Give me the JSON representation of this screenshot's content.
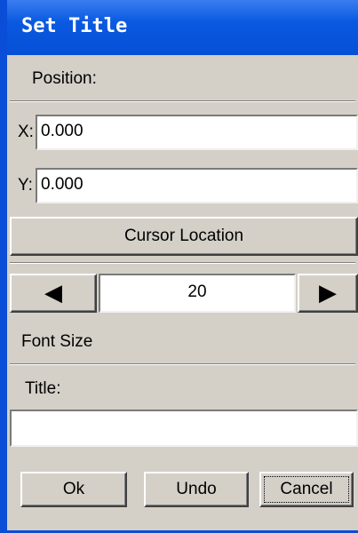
{
  "window": {
    "title": "Set Title"
  },
  "position": {
    "heading": "Position:",
    "x_label": "X:",
    "x_value": "0.000",
    "y_label": "Y:",
    "y_value": "0.000",
    "cursor_button": "Cursor Location"
  },
  "font": {
    "prev_glyph": "◀",
    "next_glyph": "▶",
    "size_value": "20",
    "size_label": "Font Size"
  },
  "title_section": {
    "label": "Title:",
    "value": ""
  },
  "buttons": {
    "ok": "Ok",
    "undo": "Undo",
    "cancel": "Cancel"
  },
  "colors": {
    "titlebar": "#0550d6",
    "face": "#d4d0c8",
    "title_text": "#ffffff"
  }
}
